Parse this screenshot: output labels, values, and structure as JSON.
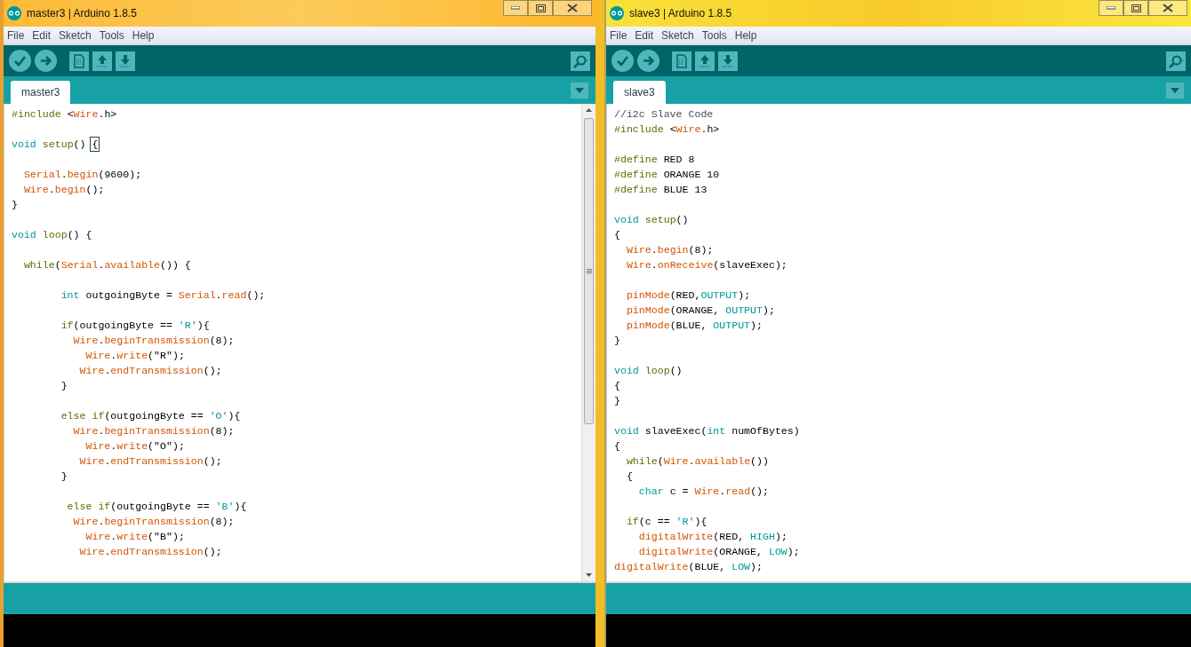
{
  "windows": [
    {
      "title": "master3 | Arduino 1.8.5",
      "menus": [
        "File",
        "Edit",
        "Sketch",
        "Tools",
        "Help"
      ],
      "tabs": [
        {
          "label": "master3",
          "selected": true
        }
      ],
      "scrollbar": true,
      "lines": [
        {
          "kind": "code",
          "segments": [
            {
              "text": "#include",
              "kind": "control"
            },
            {
              "text": " <",
              "kind": "plain"
            },
            {
              "text": "Wire",
              "kind": "function"
            },
            {
              "text": ".h>",
              "kind": "plain"
            }
          ]
        },
        {
          "kind": "blank"
        },
        {
          "kind": "code",
          "segments": [
            {
              "text": "void",
              "kind": "keyword"
            },
            {
              "text": " setup",
              "kind": "control"
            },
            {
              "text": "() ",
              "kind": "plain"
            },
            {
              "text": "{",
              "kind": "matched-bracket"
            }
          ]
        },
        {
          "kind": "blank"
        },
        {
          "kind": "code",
          "segments": [
            {
              "text": "  Serial",
              "kind": "function"
            },
            {
              "text": ".",
              "kind": "plain"
            },
            {
              "text": "begin",
              "kind": "function"
            },
            {
              "text": "(9600);",
              "kind": "plain"
            }
          ]
        },
        {
          "kind": "code",
          "segments": [
            {
              "text": "  Wire",
              "kind": "function"
            },
            {
              "text": ".",
              "kind": "plain"
            },
            {
              "text": "begin",
              "kind": "function"
            },
            {
              "text": "();",
              "kind": "plain"
            }
          ]
        },
        {
          "kind": "code",
          "segments": [
            {
              "text": "}",
              "kind": "plain"
            }
          ]
        },
        {
          "kind": "blank"
        },
        {
          "kind": "code",
          "segments": [
            {
              "text": "void",
              "kind": "keyword"
            },
            {
              "text": " loop",
              "kind": "control"
            },
            {
              "text": "() {",
              "kind": "plain"
            }
          ]
        },
        {
          "kind": "blank"
        },
        {
          "kind": "code",
          "segments": [
            {
              "text": "  while",
              "kind": "control"
            },
            {
              "text": "(",
              "kind": "plain"
            },
            {
              "text": "Serial",
              "kind": "function"
            },
            {
              "text": ".",
              "kind": "plain"
            },
            {
              "text": "available",
              "kind": "function"
            },
            {
              "text": "()) {",
              "kind": "plain"
            }
          ]
        },
        {
          "kind": "blank"
        },
        {
          "kind": "code",
          "segments": [
            {
              "text": "        int",
              "kind": "keyword"
            },
            {
              "text": " outgoingByte = ",
              "kind": "plain"
            },
            {
              "text": "Serial",
              "kind": "function"
            },
            {
              "text": ".",
              "kind": "plain"
            },
            {
              "text": "read",
              "kind": "function"
            },
            {
              "text": "();",
              "kind": "plain"
            }
          ]
        },
        {
          "kind": "blank"
        },
        {
          "kind": "code",
          "segments": [
            {
              "text": "        if",
              "kind": "control"
            },
            {
              "text": "(outgoingByte == ",
              "kind": "plain"
            },
            {
              "text": "'R'",
              "kind": "keyword"
            },
            {
              "text": "){",
              "kind": "plain"
            }
          ]
        },
        {
          "kind": "code",
          "segments": [
            {
              "text": "          Wire",
              "kind": "function"
            },
            {
              "text": ".",
              "kind": "plain"
            },
            {
              "text": "beginTransmission",
              "kind": "function"
            },
            {
              "text": "(8);",
              "kind": "plain"
            }
          ]
        },
        {
          "kind": "code",
          "segments": [
            {
              "text": "            Wire",
              "kind": "function"
            },
            {
              "text": ".",
              "kind": "plain"
            },
            {
              "text": "write",
              "kind": "function"
            },
            {
              "text": "(\"R\");",
              "kind": "plain"
            }
          ]
        },
        {
          "kind": "code",
          "segments": [
            {
              "text": "           Wire",
              "kind": "function"
            },
            {
              "text": ".",
              "kind": "plain"
            },
            {
              "text": "endTransmission",
              "kind": "function"
            },
            {
              "text": "();",
              "kind": "plain"
            }
          ]
        },
        {
          "kind": "code",
          "segments": [
            {
              "text": "        }",
              "kind": "plain"
            }
          ]
        },
        {
          "kind": "blank"
        },
        {
          "kind": "code",
          "segments": [
            {
              "text": "        else",
              "kind": "control"
            },
            {
              "text": " if",
              "kind": "control"
            },
            {
              "text": "(outgoingByte == ",
              "kind": "plain"
            },
            {
              "text": "'O'",
              "kind": "keyword"
            },
            {
              "text": "){",
              "kind": "plain"
            }
          ]
        },
        {
          "kind": "code",
          "segments": [
            {
              "text": "          Wire",
              "kind": "function"
            },
            {
              "text": ".",
              "kind": "plain"
            },
            {
              "text": "beginTransmission",
              "kind": "function"
            },
            {
              "text": "(8);",
              "kind": "plain"
            }
          ]
        },
        {
          "kind": "code",
          "segments": [
            {
              "text": "            Wire",
              "kind": "function"
            },
            {
              "text": ".",
              "kind": "plain"
            },
            {
              "text": "write",
              "kind": "function"
            },
            {
              "text": "(\"O\");",
              "kind": "plain"
            }
          ]
        },
        {
          "kind": "code",
          "segments": [
            {
              "text": "           Wire",
              "kind": "function"
            },
            {
              "text": ".",
              "kind": "plain"
            },
            {
              "text": "endTransmission",
              "kind": "function"
            },
            {
              "text": "();",
              "kind": "plain"
            }
          ]
        },
        {
          "kind": "code",
          "segments": [
            {
              "text": "        }",
              "kind": "plain"
            }
          ]
        },
        {
          "kind": "blank"
        },
        {
          "kind": "code",
          "segments": [
            {
              "text": "         else",
              "kind": "control"
            },
            {
              "text": " if",
              "kind": "control"
            },
            {
              "text": "(outgoingByte == ",
              "kind": "plain"
            },
            {
              "text": "'B'",
              "kind": "keyword"
            },
            {
              "text": "){",
              "kind": "plain"
            }
          ]
        },
        {
          "kind": "code",
          "segments": [
            {
              "text": "          Wire",
              "kind": "function"
            },
            {
              "text": ".",
              "kind": "plain"
            },
            {
              "text": "beginTransmission",
              "kind": "function"
            },
            {
              "text": "(8);",
              "kind": "plain"
            }
          ]
        },
        {
          "kind": "code",
          "segments": [
            {
              "text": "            Wire",
              "kind": "function"
            },
            {
              "text": ".",
              "kind": "plain"
            },
            {
              "text": "write",
              "kind": "function"
            },
            {
              "text": "(\"B\");",
              "kind": "plain"
            }
          ]
        },
        {
          "kind": "code",
          "segments": [
            {
              "text": "           Wire",
              "kind": "function"
            },
            {
              "text": ".",
              "kind": "plain"
            },
            {
              "text": "endTransmission",
              "kind": "function"
            },
            {
              "text": "();",
              "kind": "plain"
            }
          ]
        }
      ]
    },
    {
      "title": "slave3 | Arduino 1.8.5",
      "menus": [
        "File",
        "Edit",
        "Sketch",
        "Tools",
        "Help"
      ],
      "tabs": [
        {
          "label": "slave3",
          "selected": true
        }
      ],
      "scrollbar": false,
      "lines": [
        {
          "kind": "code",
          "segments": [
            {
              "text": "//i2c Slave Code",
              "kind": "comment"
            }
          ]
        },
        {
          "kind": "code",
          "segments": [
            {
              "text": "#include",
              "kind": "control"
            },
            {
              "text": " <",
              "kind": "plain"
            },
            {
              "text": "Wire",
              "kind": "function"
            },
            {
              "text": ".h>",
              "kind": "plain"
            }
          ]
        },
        {
          "kind": "blank"
        },
        {
          "kind": "code",
          "segments": [
            {
              "text": "#define",
              "kind": "control"
            },
            {
              "text": " RED 8",
              "kind": "plain"
            }
          ]
        },
        {
          "kind": "code",
          "segments": [
            {
              "text": "#define",
              "kind": "control"
            },
            {
              "text": " ORANGE 10",
              "kind": "plain"
            }
          ]
        },
        {
          "kind": "code",
          "segments": [
            {
              "text": "#define",
              "kind": "control"
            },
            {
              "text": " BLUE 13",
              "kind": "plain"
            }
          ]
        },
        {
          "kind": "blank"
        },
        {
          "kind": "code",
          "segments": [
            {
              "text": "void",
              "kind": "keyword"
            },
            {
              "text": " setup",
              "kind": "control"
            },
            {
              "text": "()",
              "kind": "plain"
            }
          ]
        },
        {
          "kind": "code",
          "segments": [
            {
              "text": "{",
              "kind": "plain"
            }
          ]
        },
        {
          "kind": "code",
          "segments": [
            {
              "text": "  Wire",
              "kind": "function"
            },
            {
              "text": ".",
              "kind": "plain"
            },
            {
              "text": "begin",
              "kind": "function"
            },
            {
              "text": "(8);",
              "kind": "plain"
            }
          ]
        },
        {
          "kind": "code",
          "segments": [
            {
              "text": "  Wire",
              "kind": "function"
            },
            {
              "text": ".",
              "kind": "plain"
            },
            {
              "text": "onReceive",
              "kind": "function"
            },
            {
              "text": "(slaveExec);",
              "kind": "plain"
            }
          ]
        },
        {
          "kind": "blank"
        },
        {
          "kind": "code",
          "segments": [
            {
              "text": "  pinMode",
              "kind": "function"
            },
            {
              "text": "(RED,",
              "kind": "plain"
            },
            {
              "text": "OUTPUT",
              "kind": "keyword"
            },
            {
              "text": ");",
              "kind": "plain"
            }
          ]
        },
        {
          "kind": "code",
          "segments": [
            {
              "text": "  pinMode",
              "kind": "function"
            },
            {
              "text": "(ORANGE, ",
              "kind": "plain"
            },
            {
              "text": "OUTPUT",
              "kind": "keyword"
            },
            {
              "text": ");",
              "kind": "plain"
            }
          ]
        },
        {
          "kind": "code",
          "segments": [
            {
              "text": "  pinMode",
              "kind": "function"
            },
            {
              "text": "(BLUE, ",
              "kind": "plain"
            },
            {
              "text": "OUTPUT",
              "kind": "keyword"
            },
            {
              "text": ");",
              "kind": "plain"
            }
          ]
        },
        {
          "kind": "code",
          "segments": [
            {
              "text": "}",
              "kind": "plain"
            }
          ]
        },
        {
          "kind": "blank"
        },
        {
          "kind": "code",
          "segments": [
            {
              "text": "void",
              "kind": "keyword"
            },
            {
              "text": " loop",
              "kind": "control"
            },
            {
              "text": "()",
              "kind": "plain"
            }
          ]
        },
        {
          "kind": "code",
          "segments": [
            {
              "text": "{",
              "kind": "plain"
            }
          ]
        },
        {
          "kind": "code",
          "segments": [
            {
              "text": "}",
              "kind": "plain"
            }
          ]
        },
        {
          "kind": "blank"
        },
        {
          "kind": "code",
          "segments": [
            {
              "text": "void",
              "kind": "keyword"
            },
            {
              "text": " slaveExec(",
              "kind": "plain"
            },
            {
              "text": "int",
              "kind": "keyword"
            },
            {
              "text": " numOfBytes)",
              "kind": "plain"
            }
          ]
        },
        {
          "kind": "code",
          "segments": [
            {
              "text": "{",
              "kind": "plain"
            }
          ]
        },
        {
          "kind": "code",
          "segments": [
            {
              "text": "  while",
              "kind": "control"
            },
            {
              "text": "(",
              "kind": "plain"
            },
            {
              "text": "Wire",
              "kind": "function"
            },
            {
              "text": ".",
              "kind": "plain"
            },
            {
              "text": "available",
              "kind": "function"
            },
            {
              "text": "())",
              "kind": "plain"
            }
          ]
        },
        {
          "kind": "code",
          "segments": [
            {
              "text": "  {",
              "kind": "plain"
            }
          ]
        },
        {
          "kind": "code",
          "segments": [
            {
              "text": "    char",
              "kind": "keyword"
            },
            {
              "text": " c = ",
              "kind": "plain"
            },
            {
              "text": "Wire",
              "kind": "function"
            },
            {
              "text": ".",
              "kind": "plain"
            },
            {
              "text": "read",
              "kind": "function"
            },
            {
              "text": "();",
              "kind": "plain"
            }
          ]
        },
        {
          "kind": "blank"
        },
        {
          "kind": "code",
          "segments": [
            {
              "text": "  if",
              "kind": "control"
            },
            {
              "text": "(c == ",
              "kind": "plain"
            },
            {
              "text": "'R'",
              "kind": "keyword"
            },
            {
              "text": "){",
              "kind": "plain"
            }
          ]
        },
        {
          "kind": "code",
          "segments": [
            {
              "text": "    digitalWrite",
              "kind": "function"
            },
            {
              "text": "(RED, ",
              "kind": "plain"
            },
            {
              "text": "HIGH",
              "kind": "keyword"
            },
            {
              "text": ");",
              "kind": "plain"
            }
          ]
        },
        {
          "kind": "code",
          "segments": [
            {
              "text": "    digitalWrite",
              "kind": "function"
            },
            {
              "text": "(ORANGE, ",
              "kind": "plain"
            },
            {
              "text": "LOW",
              "kind": "keyword"
            },
            {
              "text": ");",
              "kind": "plain"
            }
          ]
        },
        {
          "kind": "code",
          "segments": [
            {
              "text": "digitalWrite",
              "kind": "function"
            },
            {
              "text": "(BLUE, ",
              "kind": "plain"
            },
            {
              "text": "LOW",
              "kind": "keyword"
            },
            {
              "text": ");",
              "kind": "plain"
            }
          ]
        }
      ]
    }
  ]
}
